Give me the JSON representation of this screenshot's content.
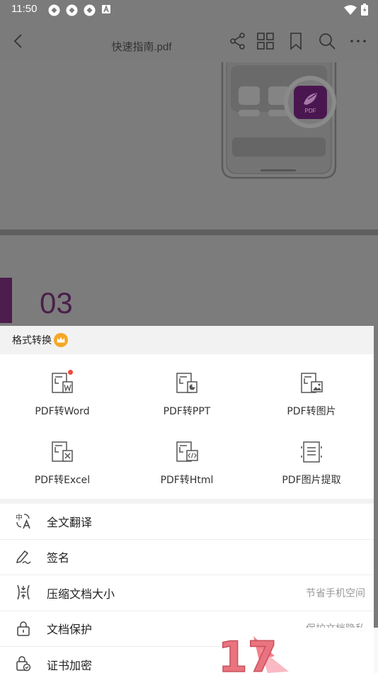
{
  "status_bar": {
    "time": "11:50",
    "icons": [
      "sync-icon",
      "sync-icon",
      "sync-icon",
      "font-a-icon"
    ],
    "right_icons": [
      "wifi-icon",
      "battery-charging-icon"
    ]
  },
  "nav": {
    "title": "快速指南.pdf",
    "icons": [
      "back-icon",
      "share-icon",
      "grid-view-icon",
      "bookmark-icon",
      "search-icon",
      "more-icon"
    ]
  },
  "document": {
    "chapter_number": "03",
    "app_badge_text": "PDF"
  },
  "sheet": {
    "header": "格式转换",
    "header_icon": "crown-icon",
    "accent_color": "#f5a623",
    "convert_items": [
      {
        "label": "PDF转Word",
        "icon": "pdf-to-word-icon",
        "badge": true
      },
      {
        "label": "PDF转PPT",
        "icon": "pdf-to-ppt-icon",
        "badge": false
      },
      {
        "label": "PDF转图片",
        "icon": "pdf-to-image-icon",
        "badge": false
      },
      {
        "label": "PDF转Excel",
        "icon": "pdf-to-excel-icon",
        "badge": false
      },
      {
        "label": "PDF转Html",
        "icon": "pdf-to-html-icon",
        "badge": false
      },
      {
        "label": "PDF图片提取",
        "icon": "pdf-extract-images-icon",
        "badge": false
      }
    ],
    "list_items": [
      {
        "label": "全文翻译",
        "hint": "",
        "icon": "translate-icon"
      },
      {
        "label": "签名",
        "hint": "",
        "icon": "signature-icon"
      },
      {
        "label": "压缩文档大小",
        "hint": "节省手机空间",
        "icon": "compress-icon"
      },
      {
        "label": "文档保护",
        "hint": "保护文档隐私",
        "icon": "lock-icon"
      },
      {
        "label": "证书加密",
        "hint": "",
        "icon": "certificate-lock-icon"
      }
    ]
  },
  "watermark_text": "17"
}
